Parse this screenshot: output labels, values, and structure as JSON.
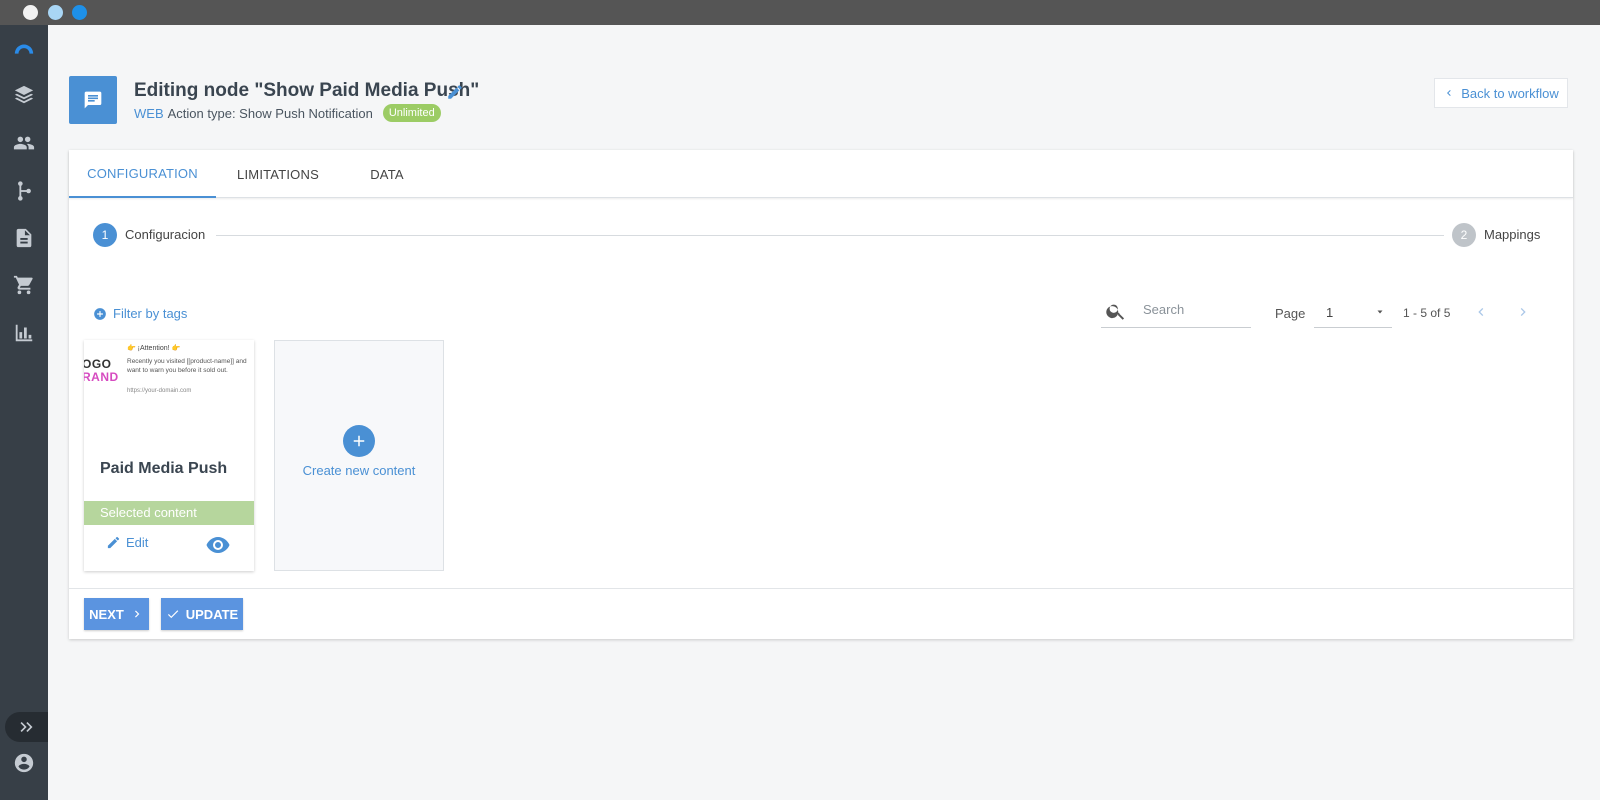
{
  "header": {
    "title": "Editing node \"Show Paid Media Push\"",
    "channel": "WEB",
    "action_type": "Action type: Show Push Notification",
    "badge": "Unlimited",
    "back_label": "Back to workflow"
  },
  "tabs": [
    "CONFIGURATION",
    "LIMITATIONS",
    "DATA"
  ],
  "active_tab": "CONFIGURATION",
  "stepper": {
    "steps": [
      {
        "number": "1",
        "label": "Configuracion"
      },
      {
        "number": "2",
        "label": "Mappings"
      }
    ],
    "active_step": 1
  },
  "toolbar": {
    "filter_label": "Filter by tags",
    "search_placeholder": "Search",
    "page_label": "Page",
    "page_value": "1",
    "range_text": "1 - 5 of 5"
  },
  "content_tile": {
    "preview": {
      "logo_line1": "OGO",
      "logo_line2": "RAND",
      "attention": "👉 ¡Attention! 👉",
      "body": "Recently you visited [[product-name]] and want to warn you before it sold out.",
      "url": "https://your-domain.com"
    },
    "name": "Paid Media Push",
    "status": "Selected content",
    "edit_label": "Edit"
  },
  "create_tile": {
    "label": "Create new content"
  },
  "footer": {
    "next_label": "NEXT",
    "update_label": "UPDATE"
  },
  "colors": {
    "accent": "#4a90d4",
    "badge_green": "#9ccc65",
    "selected_green": "#b6d69d",
    "sidebar": "#373f47"
  },
  "sidebar": {
    "icons": [
      "logo-icon",
      "layers-icon",
      "people-icon",
      "workflow-icon",
      "document-icon",
      "cart-icon",
      "chart-icon"
    ],
    "bottom_icons": [
      "expand-icon",
      "account-icon"
    ]
  }
}
